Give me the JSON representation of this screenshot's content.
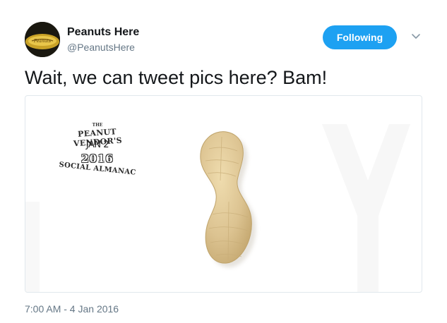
{
  "user": {
    "display_name": "Peanuts Here",
    "handle": "@PeanutsHere",
    "avatar_icon": "peanut-logo-avatar"
  },
  "actions": {
    "follow_label": "Following",
    "menu_icon": "chevron-down-icon"
  },
  "tweet": {
    "text": "Wait, we can tweet pics here? Bam!",
    "timestamp": "7:00 AM - 4 Jan 2016"
  },
  "media": {
    "stamp": {
      "top": "THE",
      "line1": "PEANUT VENDOR'S",
      "date": "JAN 2",
      "year": "2016",
      "line2": "SOCIAL ALMANAC"
    }
  },
  "colors": {
    "accent": "#1da1f2",
    "secondary_text": "#657786",
    "border": "#e1e8ed",
    "peanut": "#d9c08c"
  }
}
